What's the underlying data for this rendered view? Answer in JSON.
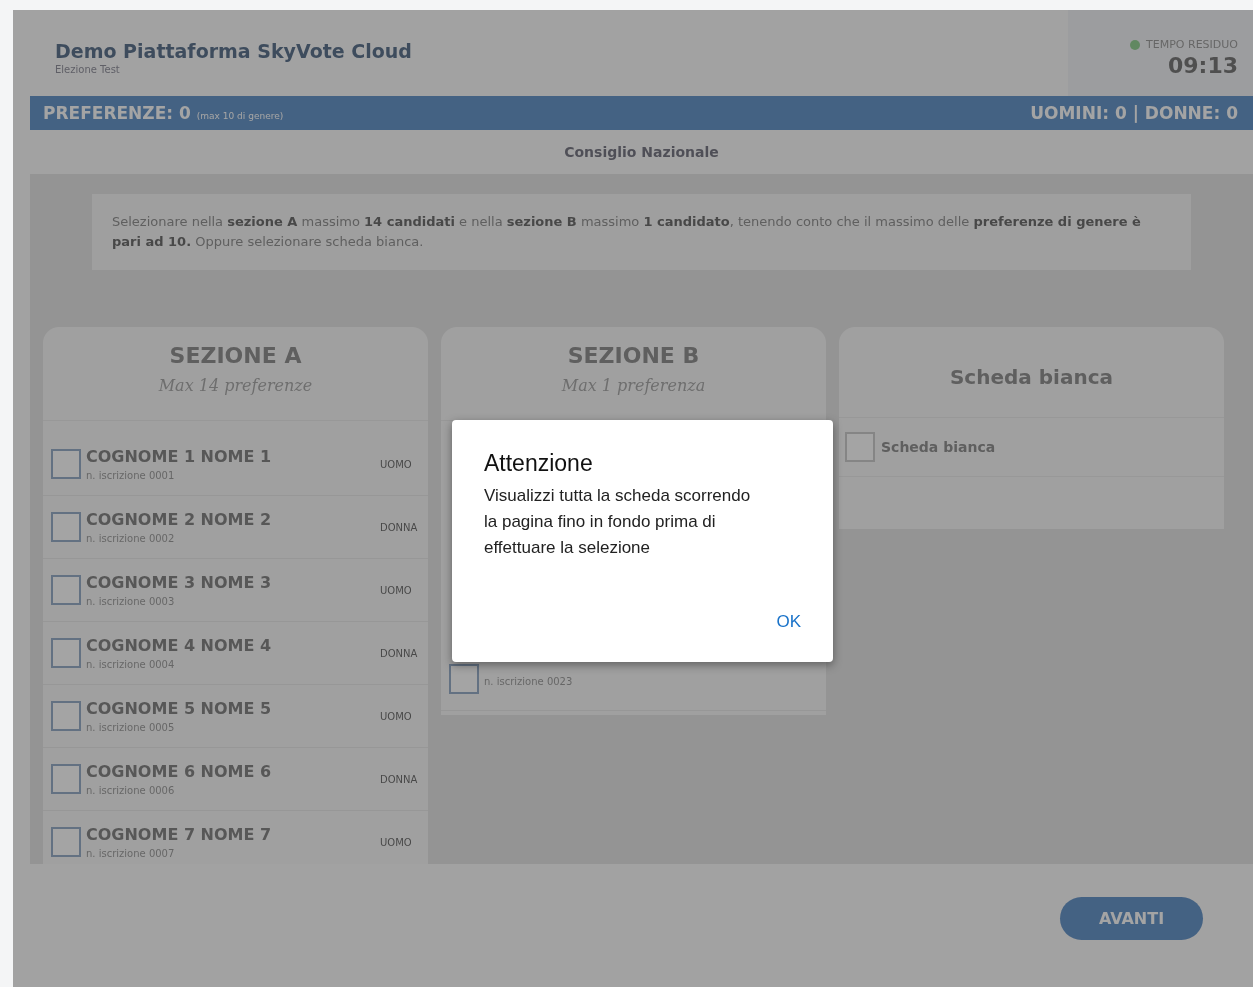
{
  "header": {
    "title": "Demo Piattaforma SkyVote Cloud",
    "subtitle": "Elezione Test",
    "timer_label": "TEMPO RESIDUO",
    "timer": "09:13"
  },
  "preferences_bar": {
    "label": "PREFERENZE: 0",
    "note": "(max 10 di genere)",
    "counts": "UOMINI: 0 | DONNE: 0"
  },
  "ballot_title": "Consiglio Nazionale",
  "instructions": "Selezionare nella **sezione A** massimo **14 candidati** e nella **sezione B** massimo **1 candidato**, tenendo conto che il massimo delle **preferenze di genere è pari ad 10.** Oppure selezionare scheda bianca.",
  "sections": [
    {
      "kind": "list",
      "title": "SEZIONE A",
      "subtitle": "Max 14 preferenze",
      "candidates": [
        {
          "name": "COGNOME 1 NOME 1",
          "number": "n. iscrizione 0001",
          "gender": "UOMO",
          "checked": false
        },
        {
          "name": "COGNOME 2 NOME 2",
          "number": "n. iscrizione 0002",
          "gender": "DONNA",
          "checked": false
        },
        {
          "name": "COGNOME 3 NOME 3",
          "number": "n. iscrizione 0003",
          "gender": "UOMO",
          "checked": false
        },
        {
          "name": "COGNOME 4 NOME 4",
          "number": "n. iscrizione 0004",
          "gender": "DONNA",
          "checked": false
        },
        {
          "name": "COGNOME 5 NOME 5",
          "number": "n. iscrizione 0005",
          "gender": "UOMO",
          "checked": false
        },
        {
          "name": "COGNOME 6 NOME 6",
          "number": "n. iscrizione 0006",
          "gender": "DONNA",
          "checked": false
        },
        {
          "name": "COGNOME 7 NOME 7",
          "number": "n. iscrizione 0007",
          "gender": "UOMO",
          "checked": false
        }
      ]
    },
    {
      "kind": "list",
      "title": "SEZIONE B",
      "subtitle": "Max 1 preferenza",
      "candidates": [
        {
          "number": "n. iscrizione 0023",
          "checked": false
        }
      ]
    },
    {
      "kind": "blank",
      "title": "Scheda bianca",
      "option": {
        "label": "Scheda bianca",
        "checked": false
      }
    }
  ],
  "next_button": "AVANTI",
  "dialog": {
    "title": "Attenzione",
    "message": "Visualizzi tutta la scheda scorrendo la pagina fino in fondo prima di effettuare la selezione",
    "button": "OK"
  }
}
